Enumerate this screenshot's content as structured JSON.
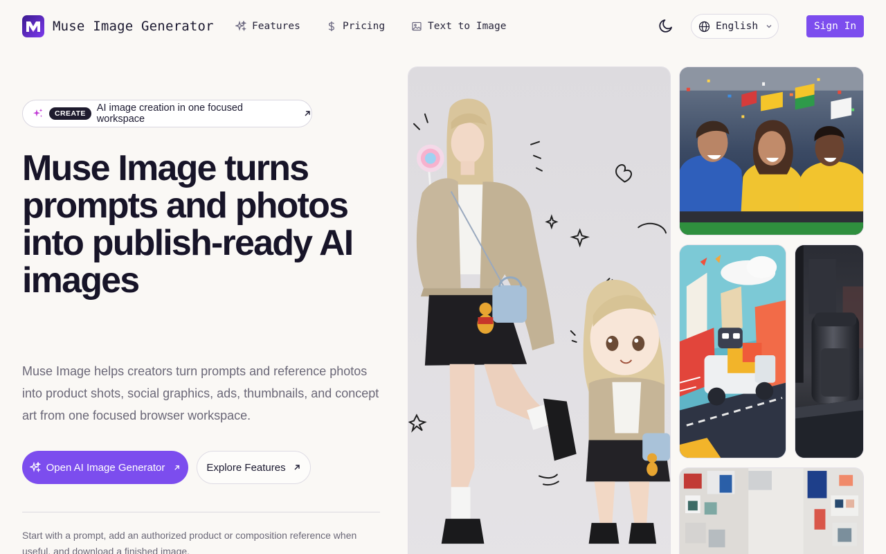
{
  "header": {
    "brand": "Muse Image Generator",
    "logo_icon": "muse-logo-icon",
    "nav": [
      {
        "label": "Features",
        "icon": "sparkles-icon"
      },
      {
        "label": "Pricing",
        "icon": "dollar-icon"
      },
      {
        "label": "Text to Image",
        "icon": "image-icon"
      }
    ],
    "theme_icon": "moon-icon",
    "language": "English",
    "sign_in": "Sign In"
  },
  "hero": {
    "badge": "CREATE",
    "pill_text": "AI image creation in one focused workspace",
    "title": "Muse Image turns prompts and photos into publish-ready AI images",
    "description": "Muse Image helps creators turn prompts and reference photos into product shots, social graphics, ads, thumbnails, and concept art from one focused browser workspace.",
    "primary_cta": "Open AI Image Generator",
    "secondary_cta": "Explore Features",
    "footnote": "Start with a prompt, add an authorized product or composition reference when useful, and download a finished image."
  },
  "colors": {
    "accent": "#7c4dee",
    "background": "#faf8f5",
    "text": "#171428",
    "muted": "#6a6777"
  },
  "gallery": {
    "images": [
      "gallery-main-image",
      "gallery-fans-image",
      "gallery-robot-image",
      "gallery-jar-image",
      "gallery-studio-image"
    ]
  }
}
